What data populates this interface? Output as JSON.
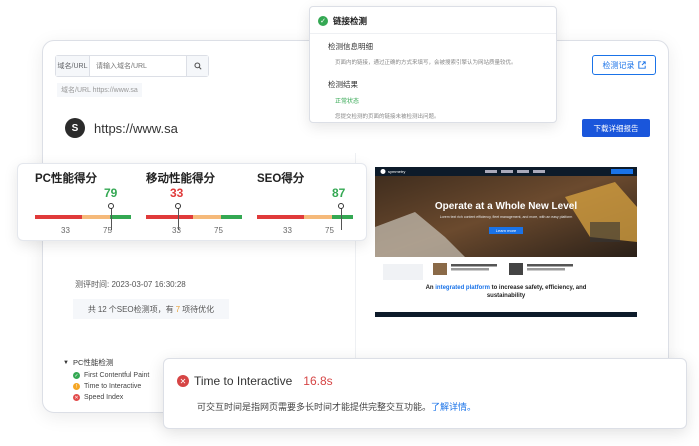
{
  "search": {
    "prefix": "域名/URL",
    "placeholder": "请输入域名/URL"
  },
  "domain_line": "域名/URL  https://www.sa",
  "record_button": "检测记录",
  "site": {
    "logo": "S",
    "url": "https://www.sa"
  },
  "download_button": "下载详细报告",
  "test_time": "测评时间: 2023-03-07 16:30:28",
  "summary": {
    "prefix": "共",
    "count": "12",
    "mid": "个SEO检测项，有",
    "warn": "7",
    "suffix": "项待优化"
  },
  "preview": {
    "brand": "symmetry",
    "headline": "Operate at a Whole New Level",
    "subtext": "Lorem text rich content efficiency, fleet management, and more, with an easy platform",
    "cta": "Learn more",
    "section_title_pre": "An",
    "section_title_hl": "integrated platform",
    "section_title_post": "to increase safety, efficiency, and sustainability",
    "colors": {
      "bg": "#0e2a47",
      "accent": "#1a73e8"
    }
  },
  "scores": [
    {
      "label": "PC性能得分",
      "value": "79",
      "color": "#34a853",
      "ticks": [
        "33",
        "75"
      ],
      "level": 79
    },
    {
      "label": "移动性能得分",
      "value": "33",
      "color": "#e03a3a",
      "ticks": [
        "33",
        "75"
      ],
      "level": 33
    },
    {
      "label": "SEO得分",
      "value": "87",
      "color": "#34a853",
      "ticks": [
        "33",
        "75"
      ],
      "level": 87
    }
  ],
  "link_popup": {
    "title": "链接检测",
    "section1_title": "检测信息明细",
    "section1_text": "页面内的链接，通过正确的方式来填写，会被搜索引擎认为网站质量较优。",
    "section2_title": "检测结果",
    "status": "正常状态",
    "section2_text": "您提交检测的页面的链接未被检测出问题。"
  },
  "pc_section": {
    "title": "PC性能检测",
    "items": [
      {
        "label": "First Contentful Paint",
        "status": "pass"
      },
      {
        "label": "Time to Interactive",
        "status": "warn"
      },
      {
        "label": "Speed Index",
        "status": "fail"
      }
    ]
  },
  "tti_popup": {
    "title": "Time to Interactive",
    "value": "16.8s",
    "desc": "可交互时间是指网页需要多长时间才能提供完整交互功能。",
    "link": "了解详情。"
  }
}
